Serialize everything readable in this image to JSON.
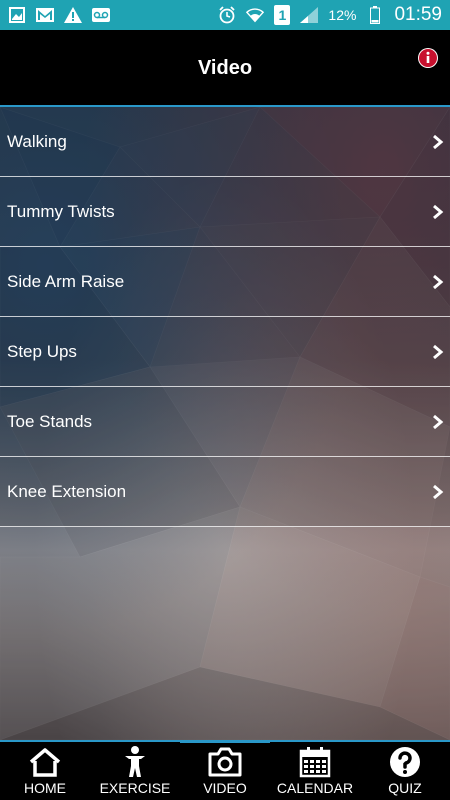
{
  "status_bar": {
    "battery_percent": "12%",
    "time": "01:59",
    "sim_slot": "1"
  },
  "header": {
    "title": "Video"
  },
  "list": {
    "items": [
      {
        "label": "Walking"
      },
      {
        "label": "Tummy Twists"
      },
      {
        "label": "Side Arm Raise"
      },
      {
        "label": "Step Ups"
      },
      {
        "label": "Toe Stands"
      },
      {
        "label": "Knee Extension"
      }
    ]
  },
  "bottom_nav": {
    "items": [
      {
        "label": "HOME",
        "icon": "home-icon"
      },
      {
        "label": "EXERCISE",
        "icon": "person-icon"
      },
      {
        "label": "VIDEO",
        "icon": "camera-icon"
      },
      {
        "label": "CALENDAR",
        "icon": "calendar-icon"
      },
      {
        "label": "QUIZ",
        "icon": "question-icon"
      }
    ],
    "active": "VIDEO"
  },
  "colors": {
    "status_bar_bg": "#1fa3b3",
    "accent": "#2a98c9",
    "info_icon": "#c8102e"
  }
}
